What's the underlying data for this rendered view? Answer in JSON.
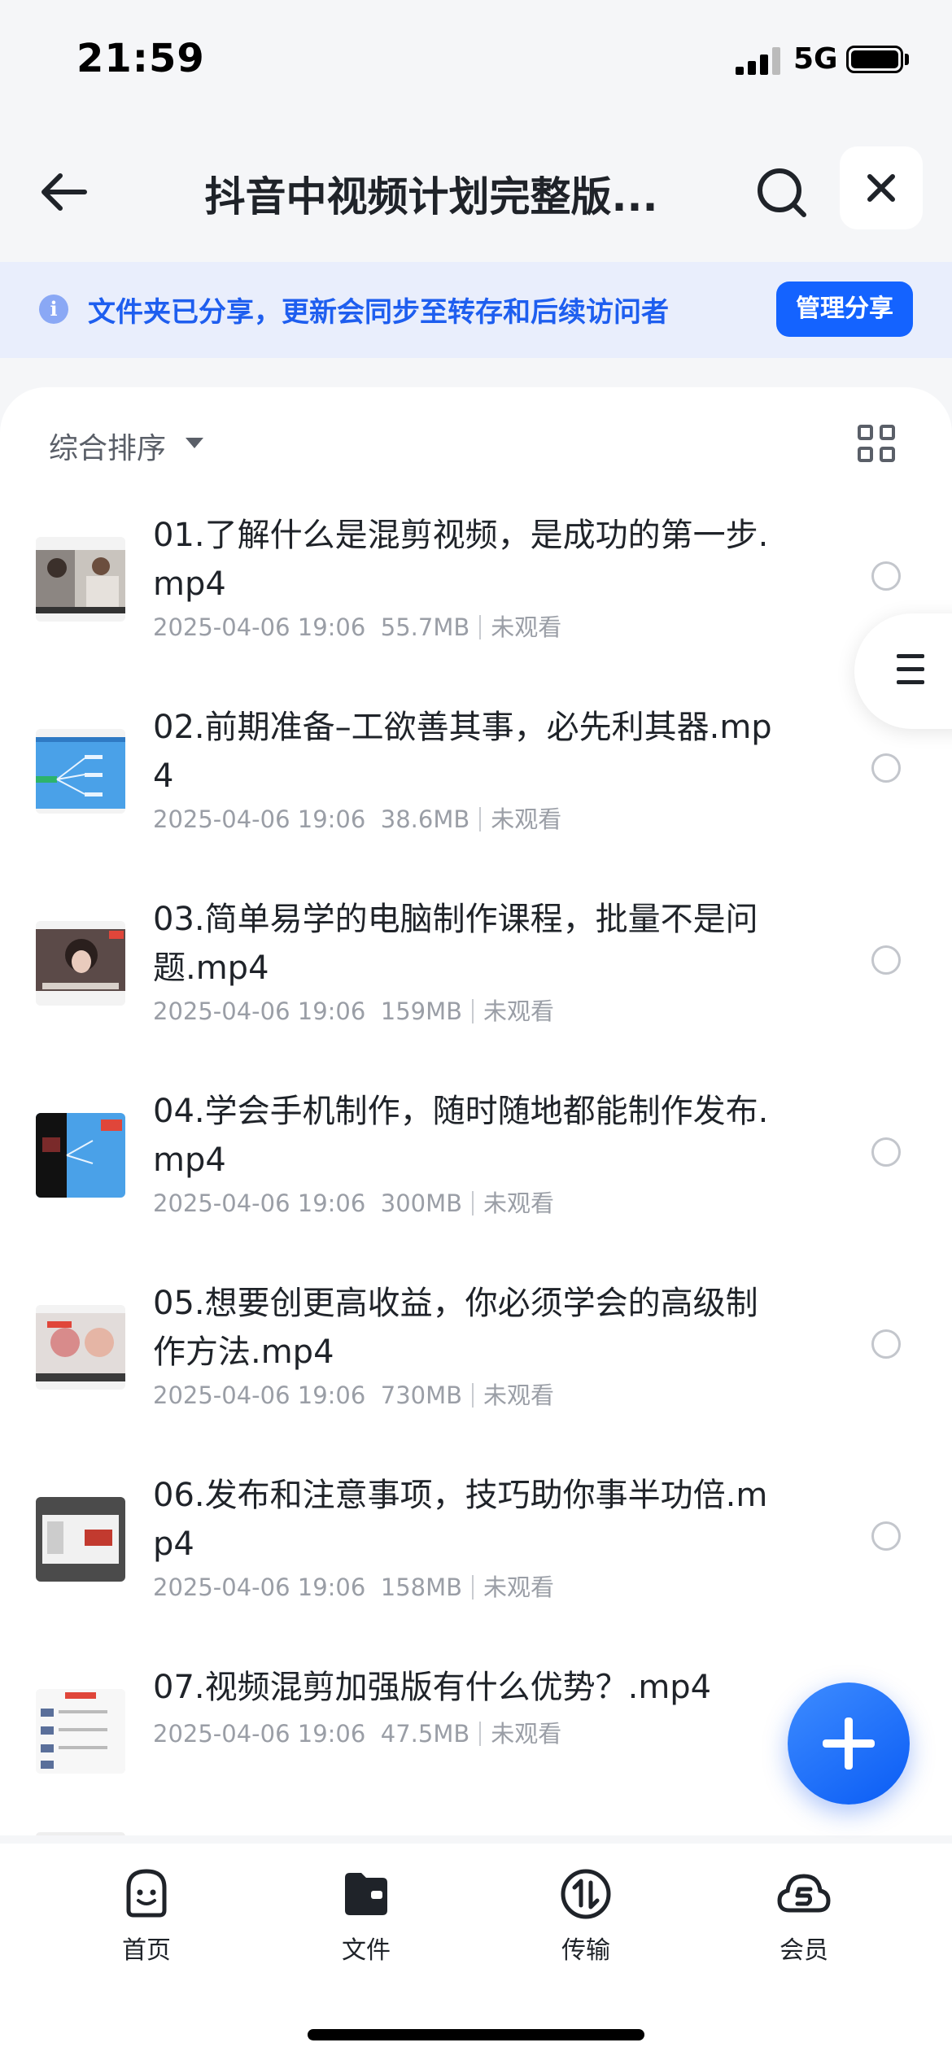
{
  "status_bar": {
    "time": "21:59",
    "network": "5G"
  },
  "header": {
    "title": "抖音中视频计划完整版..."
  },
  "banner": {
    "text": "文件夹已分享，更新会同步至转存和后续访问者",
    "button_label": "管理分享",
    "icon": "i"
  },
  "sort": {
    "label": "综合排序"
  },
  "files": [
    {
      "name": "01.了解什么是混剪视频，是成功的第一步.mp4",
      "date": "2025-04-06 19:06",
      "size": "55.7MB",
      "status": "未观看"
    },
    {
      "name": "02.前期准备–工欲善其事，必先利其器.mp4",
      "date": "2025-04-06 19:06",
      "size": "38.6MB",
      "status": "未观看"
    },
    {
      "name": "03.简单易学的电脑制作课程，批量不是问题.mp4",
      "date": "2025-04-06 19:06",
      "size": "159MB",
      "status": "未观看"
    },
    {
      "name": "04.学会手机制作，随时随地都能制作发布.mp4",
      "date": "2025-04-06 19:06",
      "size": "300MB",
      "status": "未观看"
    },
    {
      "name": "05.想要创更高收益，你必须学会的高级制作方法.mp4",
      "date": "2025-04-06 19:06",
      "size": "730MB",
      "status": "未观看"
    },
    {
      "name": "06.发布和注意事项，技巧助你事半功倍.mp4",
      "date": "2025-04-06 19:06",
      "size": "158MB",
      "status": "未观看"
    },
    {
      "name": "07.视频混剪加强版有什么优势？.mp4",
      "date": "2025-04-06 19:06",
      "size": "47.5MB",
      "status": "未观看"
    }
  ],
  "nav": {
    "home": "首页",
    "files": "文件",
    "transfer": "传输",
    "vip": "会员"
  },
  "colors": {
    "accent": "#1463ff",
    "banner_bg": "#e9eefc",
    "banner_text": "#1e5eef"
  }
}
